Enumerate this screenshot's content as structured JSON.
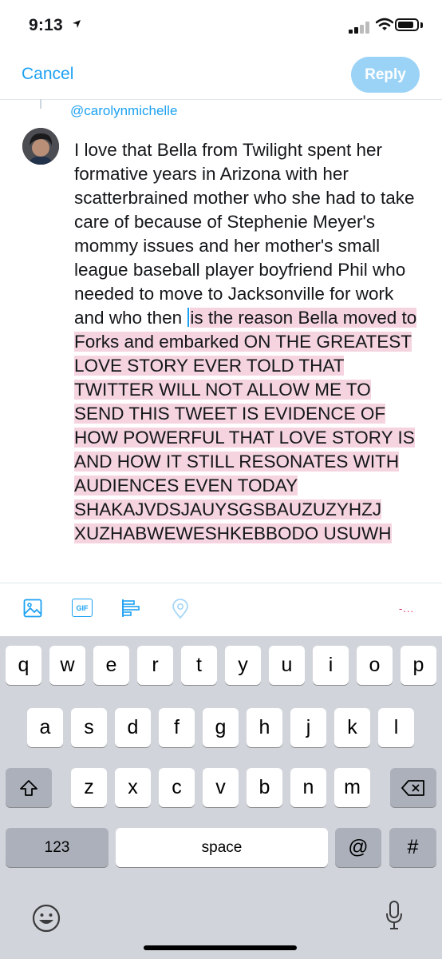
{
  "status": {
    "time": "9:13"
  },
  "nav": {
    "cancel": "Cancel",
    "reply": "Reply"
  },
  "tweet": {
    "replying_to": "@carolynmichelle",
    "text_plain": "I love that Bella from Twilight spent her formative years in Arizona with her scatterbrained mother who she had to take care of because of Stephenie Meyer's mommy issues and her mother's small league baseball player boyfriend Phil who needed to move to Jacksonville for work and who then ",
    "text_overflow": "is the reason Bella moved to Forks and embarked ON THE GREATEST LOVE STORY EVER TOLD THAT TWITTER WILL NOT ALLOW ME TO SEND THIS TWEET IS EVIDENCE OF HOW POWERFUL THAT LOVE STORY IS AND HOW IT STILL RESONATES WITH AUDIENCES EVEN TODAY SHAKAJVDSJAUYSGSBAUZUZYHZJ XUZHABWEWESHKEBBODO USUWH"
  },
  "toolbar": {
    "icons": [
      "image-icon",
      "gif-icon",
      "poll-icon",
      "location-icon"
    ],
    "gif_label": "GIF",
    "char_count": "-..."
  },
  "keyboard": {
    "row1": [
      "q",
      "w",
      "e",
      "r",
      "t",
      "y",
      "u",
      "i",
      "o",
      "p"
    ],
    "row2": [
      "a",
      "s",
      "d",
      "f",
      "g",
      "h",
      "j",
      "k",
      "l"
    ],
    "row3": [
      "z",
      "x",
      "c",
      "v",
      "b",
      "n",
      "m"
    ],
    "numbers": "123",
    "space": "space",
    "at": "@",
    "hash": "#"
  },
  "colors": {
    "accent": "#1da1f2",
    "reply_disabled": "#9bd3f7",
    "highlight": "#f5d4df",
    "over_limit": "#e0245e"
  }
}
